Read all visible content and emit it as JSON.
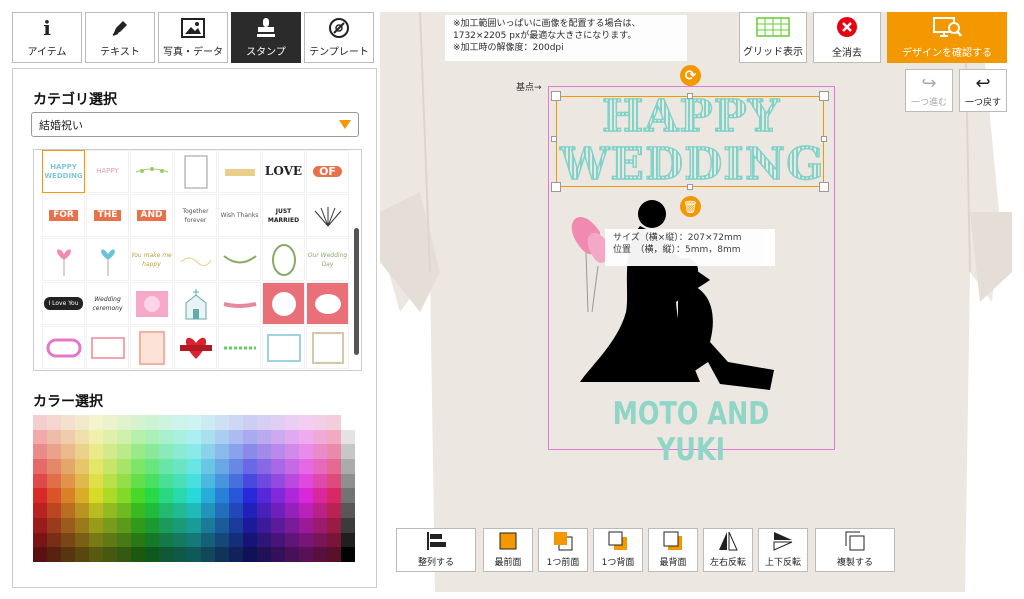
{
  "tabs": [
    {
      "label": "アイテム",
      "icon": "info-icon"
    },
    {
      "label": "テキスト",
      "icon": "pen-icon"
    },
    {
      "label": "写真・データ",
      "icon": "image-icon"
    },
    {
      "label": "スタンプ",
      "icon": "stamp-icon",
      "active": true
    },
    {
      "label": "テンプレート",
      "icon": "template-icon"
    }
  ],
  "panel": {
    "category_heading": "カテゴリ選択",
    "category_value": "結婚祝い",
    "color_heading": "カラー選択"
  },
  "stamps": {
    "row1": [
      "HAPPY WEDDING",
      "HAPPY",
      "",
      "",
      "",
      "LOVE",
      "OF"
    ],
    "row2": [
      "FOR",
      "THE",
      "AND",
      "Together forever",
      "Wish Thanks",
      "JUST MARRIED",
      ""
    ],
    "row3": [
      "",
      "",
      "You make me happy",
      "",
      "",
      "",
      "Our Wedding Day"
    ],
    "row4": [
      "I Love You",
      "Wedding ceremony",
      "",
      "",
      "",
      "",
      ""
    ],
    "row5": [
      "",
      "",
      "",
      "",
      "",
      "",
      ""
    ]
  },
  "note": {
    "line1": "※加工範囲いっぱいに画像を配置する場合は、",
    "line2": "1732×2205 pxが最適な大きさになります。",
    "line3": "※加工時の解像度：200dpi"
  },
  "top_buttons": {
    "grid": "グリッド表示",
    "clear": "全消去",
    "confirm": "デザインを確認する"
  },
  "history": {
    "redo": "一つ進む",
    "undo": "一つ戻す"
  },
  "design": {
    "base_point": "基点→",
    "line1": "HAPPY",
    "line2": "WEDDING",
    "names": "MOTO AND YUKI",
    "size_line": "サイズ（横×縦）：207×72mm",
    "pos_line": "位置　（横，縦）：5mm，8mm"
  },
  "bottom_tools": [
    {
      "label": "整列する",
      "icon": "align-icon"
    },
    {
      "label": "最前面",
      "icon": "front-icon"
    },
    {
      "label": "1つ前面",
      "icon": "forward-icon"
    },
    {
      "label": "1つ背面",
      "icon": "backward-icon"
    },
    {
      "label": "最背面",
      "icon": "back-icon"
    },
    {
      "label": "左右反転",
      "icon": "flip-h-icon"
    },
    {
      "label": "上下反転",
      "icon": "flip-v-icon"
    },
    {
      "label": "複製する",
      "icon": "duplicate-icon"
    }
  ],
  "colors": {
    "accent": "#f39800",
    "red": "#e60012",
    "mint": "#7fd3c9",
    "frame": "#e37ad9"
  }
}
